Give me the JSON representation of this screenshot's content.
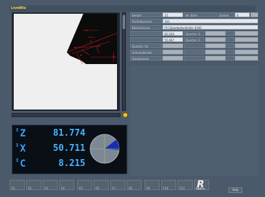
{
  "app": {
    "title": "LiveWiz"
  },
  "grid": {
    "rows": [
      {
        "label": "Bedarf",
        "value": "15",
        "label2": "Nr. Bahn",
        "label3": "Drehw",
        "value3": "6"
      },
      {
        "label": "Profil-Nummer",
        "value": "101"
      },
      {
        "label": "Bezeichnung",
        "value": "[V] Standardschleifer 0100"
      },
      {
        "label": "",
        "value": "92.030",
        "label2": "Durchm. S"
      },
      {
        "label": "",
        "value": "55.667",
        "label2": "Durchm. S"
      },
      {
        "label": "Durchm. Ist"
      },
      {
        "label": "Schneidwinkel"
      },
      {
        "label": "Spiralwinkel"
      }
    ]
  },
  "dro": {
    "axes": [
      {
        "name": "Z",
        "value": "81.774"
      },
      {
        "name": "X",
        "value": "50.711"
      },
      {
        "name": "C",
        "value": "8.215"
      }
    ],
    "c_axis_fraction": 0.12
  },
  "fkeys": [
    "F1",
    "F2",
    "F3",
    "F4",
    "F5",
    "F6",
    "F7",
    "F8",
    "F9",
    "F10",
    "F11",
    "F12"
  ],
  "help": "Help",
  "colors": {
    "accent": "#48b4ff",
    "title": "#ffd24a",
    "measure": "#d01818"
  }
}
